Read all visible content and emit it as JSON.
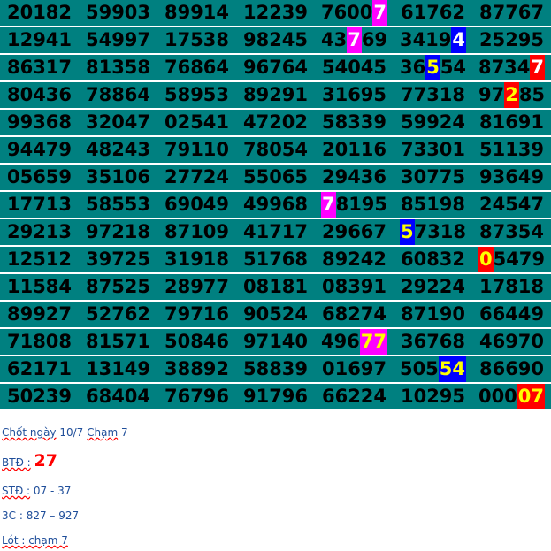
{
  "rows": [
    [
      [
        "20182"
      ],
      [
        "59903"
      ],
      [
        "89914"
      ],
      [
        "12239"
      ],
      [
        "7600",
        "7:mag"
      ],
      [
        "61762"
      ],
      [
        "87767"
      ]
    ],
    [
      [
        "12941"
      ],
      [
        "54997"
      ],
      [
        "17538"
      ],
      [
        "98245"
      ],
      [
        "43",
        "7:mag",
        "69"
      ],
      [
        "3419",
        "4:blue"
      ],
      [
        "25295"
      ]
    ],
    [
      [
        "86317"
      ],
      [
        "81358"
      ],
      [
        "76864"
      ],
      [
        "96764"
      ],
      [
        "54045"
      ],
      [
        "36",
        "5:blue-y",
        "54"
      ],
      [
        "8734",
        "7:red-w"
      ]
    ],
    [
      [
        "80436"
      ],
      [
        "78864"
      ],
      [
        "58953"
      ],
      [
        "89291"
      ],
      [
        "31695"
      ],
      [
        "77318"
      ],
      [
        "97",
        "2:red",
        "85"
      ]
    ],
    [
      [
        "99368"
      ],
      [
        "32047"
      ],
      [
        "02541"
      ],
      [
        "47202"
      ],
      [
        "58339"
      ],
      [
        "59924"
      ],
      [
        "81691"
      ]
    ],
    [
      [
        "94479"
      ],
      [
        "48243"
      ],
      [
        "79110"
      ],
      [
        "78054"
      ],
      [
        "20116"
      ],
      [
        "73301"
      ],
      [
        "51139"
      ]
    ],
    [
      [
        "05659"
      ],
      [
        "35106"
      ],
      [
        "27724"
      ],
      [
        "55065"
      ],
      [
        "29436"
      ],
      [
        "30775"
      ],
      [
        "93649"
      ]
    ],
    [
      [
        "17713"
      ],
      [
        "58553"
      ],
      [
        "69049"
      ],
      [
        "49968"
      ],
      [
        "7:mag",
        "8195"
      ],
      [
        "85198"
      ],
      [
        "24547"
      ]
    ],
    [
      [
        "29213"
      ],
      [
        "97218"
      ],
      [
        "87109"
      ],
      [
        "41717"
      ],
      [
        "29667"
      ],
      [
        "5:blue-y",
        "7318"
      ],
      [
        "87354"
      ]
    ],
    [
      [
        "12512"
      ],
      [
        "39725"
      ],
      [
        "31918"
      ],
      [
        "51768"
      ],
      [
        "89242"
      ],
      [
        "60832"
      ],
      [
        "0:red",
        "5479"
      ]
    ],
    [
      [
        "11584"
      ],
      [
        "87525"
      ],
      [
        "28977"
      ],
      [
        "08181"
      ],
      [
        "08391"
      ],
      [
        "29224"
      ],
      [
        "17818"
      ]
    ],
    [
      [
        "89927"
      ],
      [
        "52762"
      ],
      [
        "79716"
      ],
      [
        "90524"
      ],
      [
        "68274"
      ],
      [
        "87190"
      ],
      [
        "66449"
      ]
    ],
    [
      [
        "71808"
      ],
      [
        "81571"
      ],
      [
        "50846"
      ],
      [
        "97140"
      ],
      [
        "496",
        "77:mag-y"
      ],
      [
        "36768"
      ],
      [
        "46970"
      ]
    ],
    [
      [
        "62171"
      ],
      [
        "13149"
      ],
      [
        "38892"
      ],
      [
        "58839"
      ],
      [
        "01697"
      ],
      [
        "505",
        "54:blue-y"
      ],
      [
        "86690"
      ]
    ],
    [
      [
        "50239"
      ],
      [
        "68404"
      ],
      [
        "76796"
      ],
      [
        "91796"
      ],
      [
        "66224"
      ],
      [
        "10295"
      ],
      [
        "000",
        "07:red"
      ]
    ]
  ],
  "notes": {
    "line1_a": "Chốt ngày",
    "line1_b": " 10/7 ",
    "line1_c": "Chạm",
    "line1_d": " 7",
    "btd_label": "BTĐ :",
    "btd_value": "27",
    "std_label": "STĐ :",
    "std_value": " 07 - 37",
    "c3_label": "3C :",
    "c3_value": " 827  – 927",
    "lot_label": "Lót :",
    "lot_value": " chạm 7"
  },
  "colors": {
    "row_bg": "#008080",
    "magenta": "#ff00ff",
    "blue": "#0000ff",
    "red": "#ff0000",
    "yellow": "#ffff00",
    "note_text": "#1f4e9a"
  }
}
